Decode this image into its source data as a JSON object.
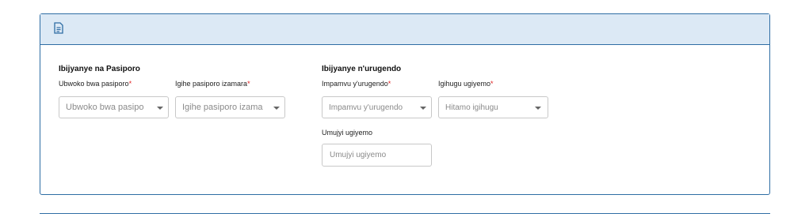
{
  "header": {
    "icon": "document-icon"
  },
  "passport_section": {
    "title": "Ibijyanye na Pasiporo",
    "passport_type": {
      "label": "Ubwoko bwa pasiporo",
      "required_mark": "*",
      "placeholder": "Ubwoko bwa pasipo"
    },
    "passport_validity": {
      "label": "Igihe pasiporo izamara",
      "required_mark": "*",
      "placeholder": "Igihe pasiporo izama"
    }
  },
  "travel_section": {
    "title": "Ibijyanye n'urugendo",
    "travel_reason": {
      "label": "Impamvu y'urugendo",
      "required_mark": "*",
      "placeholder": "Impamvu y'urugendo"
    },
    "destination_country": {
      "label": "Igihugu ugiyemo",
      "required_mark": "*",
      "placeholder": "Hitamo igihugu"
    },
    "destination_city": {
      "label": "Umujyi ugiyemo",
      "placeholder": "Umujyi ugiyemo"
    }
  },
  "colors": {
    "border": "#2e6da4",
    "header_bg": "#dce9f5",
    "required": "#e02020"
  }
}
